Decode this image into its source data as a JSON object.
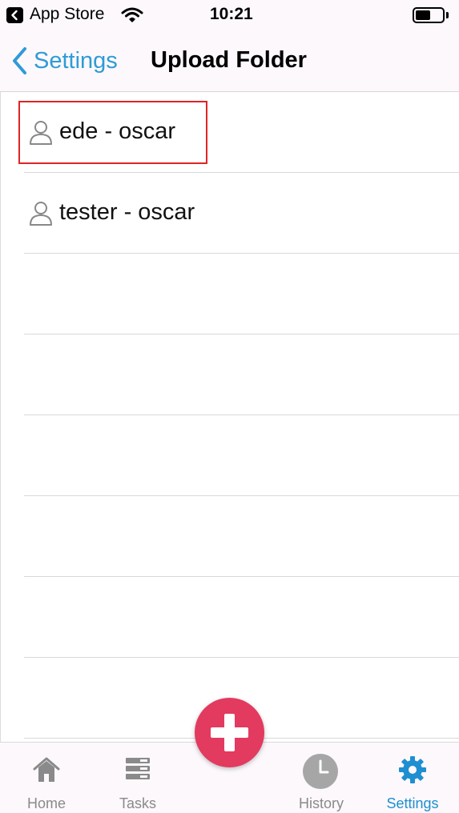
{
  "status_bar": {
    "back_app_label": "App Store",
    "time": "10:21"
  },
  "nav": {
    "back_label": "Settings",
    "title": "Upload Folder"
  },
  "list": {
    "items": [
      {
        "label": "ede - oscar",
        "icon": "user-icon"
      },
      {
        "label": "tester - oscar",
        "icon": "user-icon"
      }
    ]
  },
  "tab_bar": {
    "tabs": [
      {
        "label": "Home",
        "icon": "home-icon"
      },
      {
        "label": "Tasks",
        "icon": "tasks-icon"
      },
      {
        "label": "History",
        "icon": "clock-icon"
      },
      {
        "label": "Settings",
        "icon": "gear-icon",
        "active": true
      }
    ],
    "fab_icon": "plus-icon"
  },
  "colors": {
    "accent": "#2f9bd6",
    "fab": "#e33a5f",
    "highlight": "#e02424",
    "bar_background": "#fcf8fc"
  }
}
